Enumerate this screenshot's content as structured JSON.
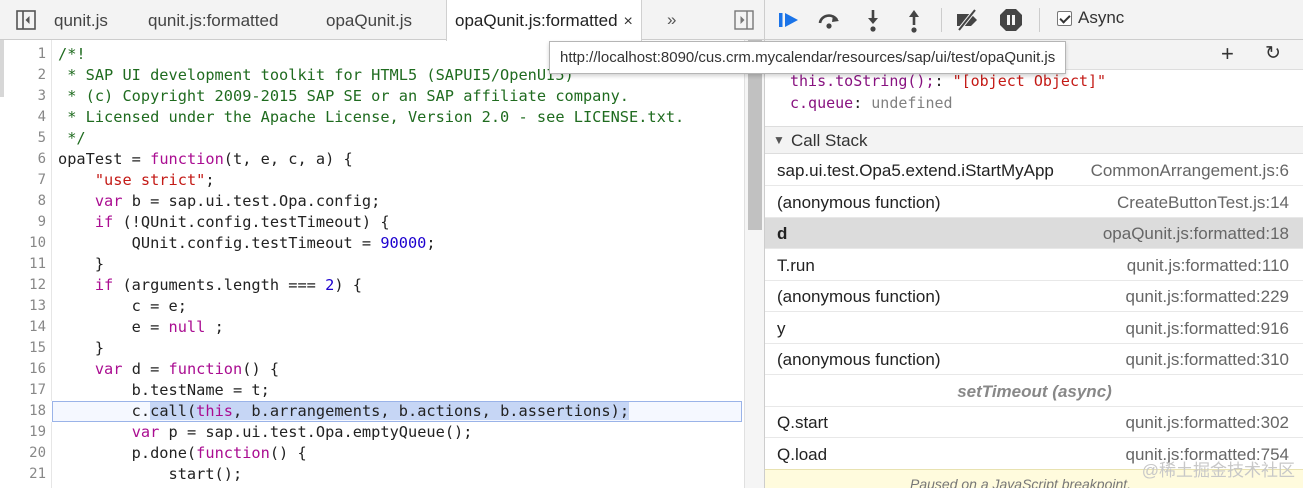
{
  "editor": {
    "tabs": [
      {
        "label": "qunit.js"
      },
      {
        "label": "qunit.js:formatted"
      },
      {
        "label": "opaQunit.js"
      },
      {
        "label": "opaQunit.js:formatted",
        "active": true
      }
    ],
    "close_glyph": "×",
    "overflow_glyph": "»",
    "tooltip": "http://localhost:8090/cus.crm.mycalendar/resources/sap/ui/test/opaQunit.js",
    "current_line": 18,
    "selection": "call(this, b.arrangements, b.actions, b.assertions);",
    "lines": [
      {
        "n": "1",
        "text": "/*!"
      },
      {
        "n": "2",
        "text": " * SAP UI development toolkit for HTML5 (SAPUI5/OpenUI5)"
      },
      {
        "n": "3",
        "text": " * (c) Copyright 2009-2015 SAP SE or an SAP affiliate company."
      },
      {
        "n": "4",
        "text": " * Licensed under the Apache License, Version 2.0 - see LICENSE.txt."
      },
      {
        "n": "5",
        "text": " */"
      },
      {
        "n": "6",
        "text": "opaTest = function(t, e, c, a) {"
      },
      {
        "n": "7",
        "text": "    \"use strict\";"
      },
      {
        "n": "8",
        "text": "    var b = sap.ui.test.Opa.config;"
      },
      {
        "n": "9",
        "text": "    if (!QUnit.config.testTimeout) {"
      },
      {
        "n": "10",
        "text": "        QUnit.config.testTimeout = 90000;"
      },
      {
        "n": "11",
        "text": "    }"
      },
      {
        "n": "12",
        "text": "    if (arguments.length === 2) {"
      },
      {
        "n": "13",
        "text": "        c = e;"
      },
      {
        "n": "14",
        "text": "        e = null ;"
      },
      {
        "n": "15",
        "text": "    }"
      },
      {
        "n": "16",
        "text": "    var d = function() {"
      },
      {
        "n": "17",
        "text": "        b.testName = t;"
      },
      {
        "n": "18",
        "text": "        c.call(this, b.arrangements, b.actions, b.assertions);"
      },
      {
        "n": "19",
        "text": "        var p = sap.ui.test.Opa.emptyQueue();"
      },
      {
        "n": "20",
        "text": "        p.done(function() {"
      },
      {
        "n": "21",
        "text": "            start();"
      }
    ]
  },
  "debugger": {
    "async_label": "Async",
    "async_checked": true,
    "add_glyph": "+",
    "refresh_glyph": "↻",
    "scope_lines": [
      {
        "name": "this.toString();",
        "sep": ": ",
        "value": "\"[object Object]\"",
        "kind": "string"
      },
      {
        "name": "c.queue",
        "sep": ": ",
        "value": "undefined",
        "kind": "undefined"
      }
    ],
    "call_stack_title": "Call Stack",
    "call_stack": [
      {
        "fn": "sap.ui.test.Opa5.extend.iStartMyApp",
        "loc": "CommonArrangement.js:6"
      },
      {
        "fn": "(anonymous function)",
        "loc": "CreateButtonTest.js:14"
      },
      {
        "fn": "d",
        "loc": "opaQunit.js:formatted:18",
        "selected": true
      },
      {
        "fn": "T.run",
        "loc": "qunit.js:formatted:110"
      },
      {
        "fn": "(anonymous function)",
        "loc": "qunit.js:formatted:229"
      },
      {
        "fn": "y",
        "loc": "qunit.js:formatted:916"
      },
      {
        "fn": "(anonymous function)",
        "loc": "qunit.js:formatted:310"
      },
      {
        "async": "setTimeout (async)"
      },
      {
        "fn": "Q.start",
        "loc": "qunit.js:formatted:302"
      },
      {
        "fn": "Q.load",
        "loc": "qunit.js:formatted:754"
      }
    ],
    "bottom_text": "Paused on a JavaScript breakpoint.",
    "watermark": "@稀土掘金技术社区"
  },
  "colors": {
    "accent": "#1a73e8",
    "selection": "#c6d6f5",
    "keyword": "#aa0d91",
    "string": "#c41a16",
    "number": "#1c00cf"
  }
}
